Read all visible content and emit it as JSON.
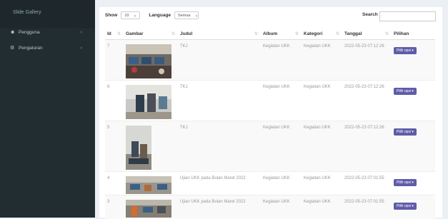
{
  "sidebar": {
    "gallery_label": "Slide Gallery",
    "items": [
      {
        "label": "Pengguna",
        "icon": "users-icon"
      },
      {
        "label": "Pengaturan",
        "icon": "cogs-icon"
      }
    ]
  },
  "toolbar": {
    "show_label": "Show",
    "show_value": "10",
    "language_label": "Language",
    "language_value": "Semua",
    "search_label": "Search"
  },
  "table": {
    "headers": [
      "Id",
      "Gambar",
      "Judul",
      "Album",
      "Kategori",
      "Tanggal",
      "Pilihan"
    ],
    "rows": [
      {
        "id": "7",
        "judul": "TKJ",
        "album": "Kegiatan UKK",
        "kategori": "Kegiatan UKK",
        "tanggal": "2022-05-23 07:12:26",
        "pilihan": "Pilih opsi ▾"
      },
      {
        "id": "6",
        "judul": "TKJ",
        "album": "Kegiatan UKK",
        "kategori": "Kegiatan UKK",
        "tanggal": "2022-05-23 07:12:26",
        "pilihan": "Pilih opsi ▾"
      },
      {
        "id": "5",
        "judul": "TKJ",
        "album": "Kegiatan UKK",
        "kategori": "Kegiatan UKK",
        "tanggal": "2022-05-23 07:12:26",
        "pilihan": "Pilih opsi ▾"
      },
      {
        "id": "4",
        "judul": "Ujian UKK pada Bulan Maret 2022",
        "album": "Kegiatan UKK",
        "kategori": "Kegiatan UKK",
        "tanggal": "2022-05-23 07:01:55",
        "pilihan": "Pilih opsi ▾"
      },
      {
        "id": "3",
        "judul": "Ujian UKK pada Bulan Maret 2022",
        "album": "Kegiatan UKK",
        "kategori": "Kegiatan UKK",
        "tanggal": "2022-05-23 07:01:55",
        "pilihan": "Pilih opsi ▾"
      }
    ]
  },
  "colors": {
    "sidebar_bg": "#222d32",
    "button_purple": "#605ca8"
  }
}
